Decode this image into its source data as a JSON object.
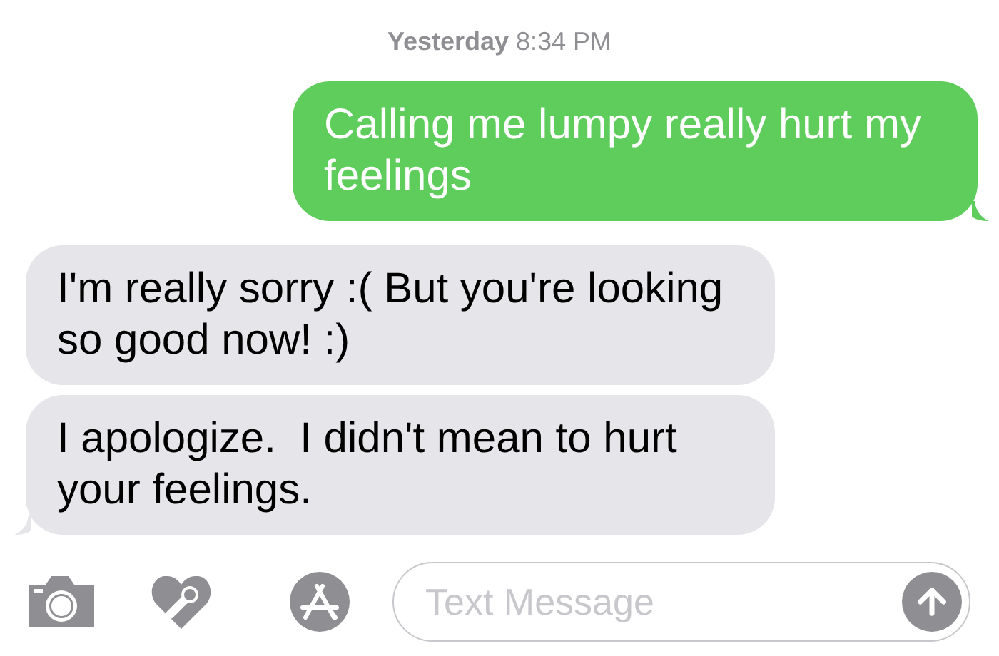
{
  "timestamp": {
    "day": "Yesterday",
    "time": "8:34 PM"
  },
  "messages": [
    {
      "kind": "sent",
      "text": "Calling me lumpy really hurt my feelings",
      "tail": true
    },
    {
      "kind": "received",
      "text": "I'm really sorry :( But you're looking so good now! :)",
      "tail": false
    },
    {
      "kind": "received",
      "text": "I apologize.  I didn't mean to hurt your feelings.",
      "tail": true
    }
  ],
  "composer": {
    "placeholder": "Text Message"
  }
}
